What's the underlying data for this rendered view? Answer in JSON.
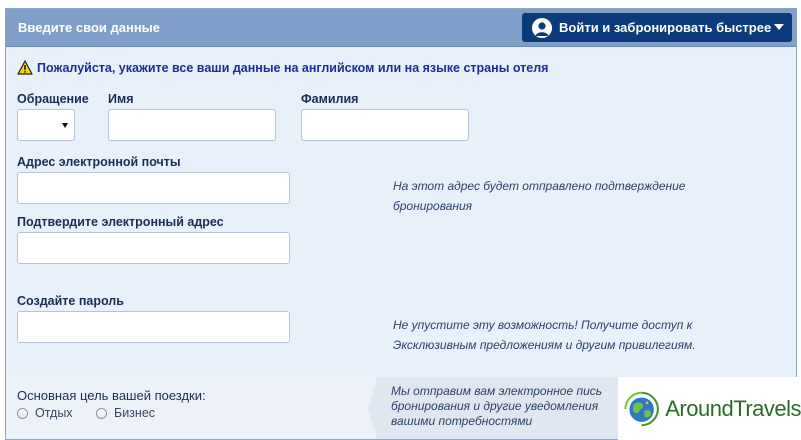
{
  "header": {
    "title": "Введите свои данные",
    "login_button": "Войти и забронировать быстрее"
  },
  "warning": {
    "text": "Пожалуйста, укажите все ваши данные на английском или на языке страны отеля"
  },
  "fields": {
    "salutation_label": "Обращение",
    "salutation_value": "",
    "first_name_label": "Имя",
    "first_name_value": "",
    "last_name_label": "Фамилия",
    "last_name_value": "",
    "email_label": "Адрес электронной почты",
    "email_value": "",
    "email_hint_line1": "На этот адрес будет отправлено подтверждение",
    "email_hint_line2": "бронирования",
    "confirm_email_label": "Подтвердите электронный адрес",
    "confirm_email_value": "",
    "password_label": "Создайте пароль",
    "password_value": "",
    "password_hint_line1": "Не упустите эту возможность! Получите доступ к",
    "password_hint_line2": "Эксклюзивным предложениям и другим привилегиям."
  },
  "trip_purpose": {
    "label": "Основная цель вашей поездки:",
    "options": [
      "Отдых",
      "Бизнес"
    ],
    "callout_line1": "Мы отправим вам электронное пись",
    "callout_line2": "бронирования и другие уведомления",
    "callout_line3": "вашими потребностями"
  },
  "watermark": {
    "brand": "AroundTravels"
  },
  "colors": {
    "header_bg": "#7f9fc9",
    "button_bg": "#0c3b7c",
    "form_bg": "#e8f0fa",
    "warning_text": "#1a2d9c",
    "brand_green": "#2d6a2a"
  },
  "icons": {
    "warning": "warning-triangle-icon",
    "user": "user-avatar-icon",
    "dropdown": "chevron-down-icon",
    "logo": "globe-logo-icon"
  }
}
